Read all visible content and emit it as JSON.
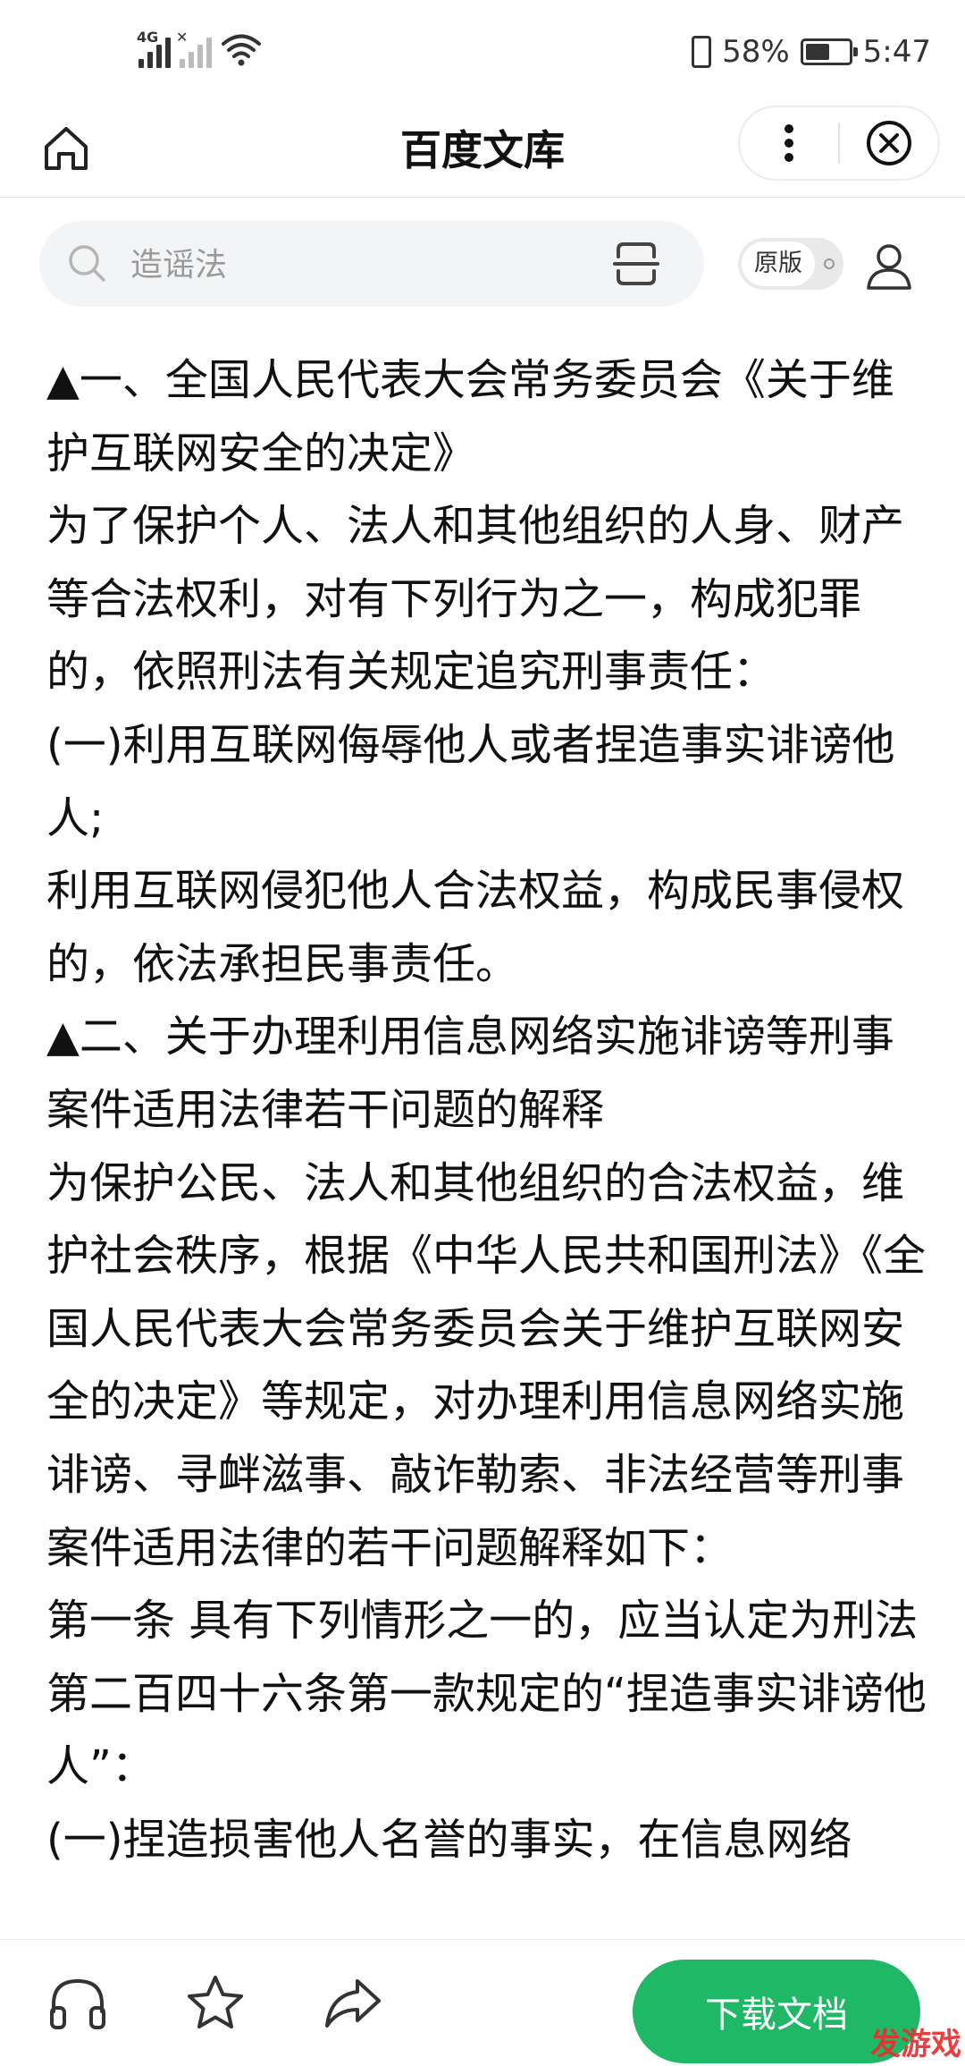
{
  "status_bar": {
    "network_tag": "4G",
    "battery_percent": "58%",
    "battery_level": 0.58,
    "time": "5:47"
  },
  "header": {
    "title": "百度文库",
    "icons": [
      "home-icon",
      "more-icon",
      "close-circle-icon"
    ]
  },
  "search": {
    "placeholder": "造谣法",
    "icons": [
      "search-icon",
      "scan-icon"
    ]
  },
  "toolbar": {
    "original_toggle_label": "原版",
    "user_icon": "user-icon"
  },
  "document": {
    "paragraphs": [
      "▲一、全国人民代表大会常务委员会《关于维护互联网安全的决定》",
      "为了保护个人、法人和其他组织的人身、财产等合法权利，对有下列行为之一，构成犯罪的，依照刑法有关规定追究刑事责任：",
      "(一)利用互联网侮辱他人或者捏造事实诽谤他人;",
      "利用互联网侵犯他人合法权益，构成民事侵权的，依法承担民事责任。",
      "▲二、关于办理利用信息网络实施诽谤等刑事案件适用法律若干问题的解释",
      "为保护公民、法人和其他组织的合法权益，维护社会秩序，根据《中华人民共和国刑法》《全国人民代表大会常务委员会关于维护互联网安全的决定》等规定，对办理利用信息网络实施诽谤、寻衅滋事、敲诈勒索、非法经营等刑事案件适用法律的若干问题解释如下：",
      "第一条 具有下列情形之一的，应当认定为刑法第二百四十六条第一款规定的“捏造事实诽谤他人”：",
      "(一)捏造损害他人名誉的事实，在信息网络"
    ]
  },
  "bottom_bar": {
    "icons": [
      "headphones-icon",
      "star-icon",
      "share-icon"
    ],
    "download_label": "下载文档",
    "watermark": "发游戏"
  },
  "colors": {
    "accent": "#1fb866",
    "watermark": "#e8302f"
  }
}
